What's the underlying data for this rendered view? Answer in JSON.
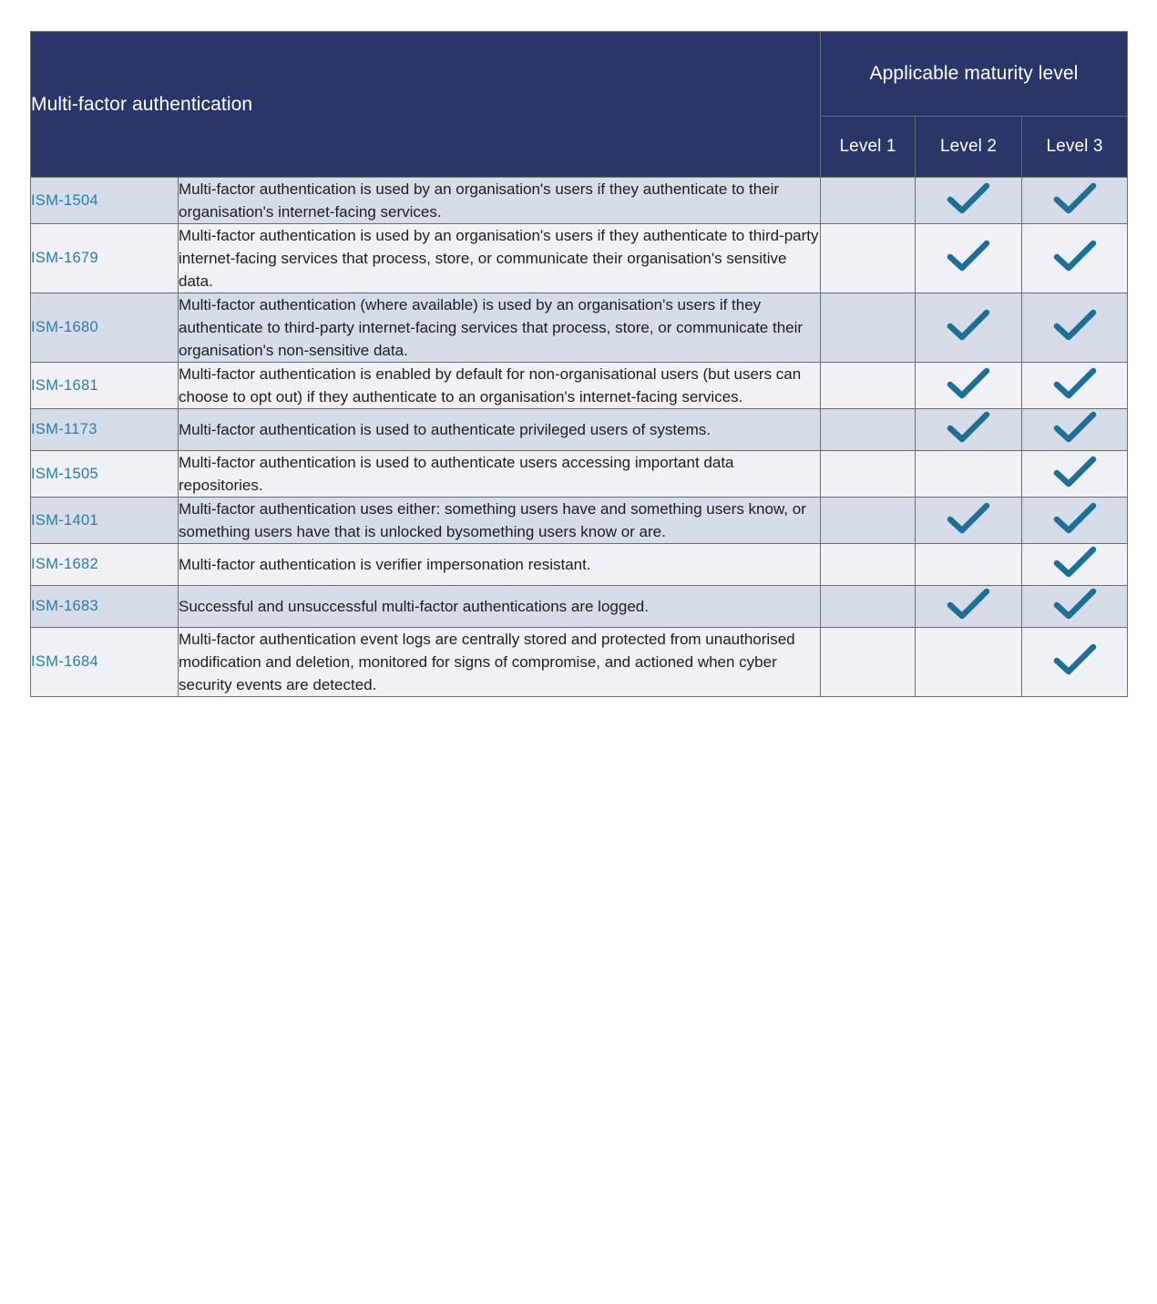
{
  "table": {
    "title": "Multi-factor authentication",
    "maturity_header": "Applicable maturity level",
    "level_headers": [
      "Level 1",
      "Level 2",
      "Level 3"
    ],
    "colors": {
      "header_navy": "#2a3568",
      "code_blue": "#2c7ba6",
      "check_teal": "#1e6e96",
      "row_shaded": "#d6dce8",
      "row_plain": "#f0f1f6",
      "border_grey": "#6a6d70"
    },
    "check_glyph": "check-icon",
    "rows": [
      {
        "code": "ISM-1504",
        "description": "Multi-factor authentication is used by an organisation's users if they authenticate to their organisation's internet-facing services.",
        "level1": false,
        "level2": true,
        "level3": true
      },
      {
        "code": "ISM-1679",
        "description": "Multi-factor authentication is used by an organisation's users if they authenticate to third-party internet-facing services that process, store, or communicate their organisation's sensitive data.",
        "level1": false,
        "level2": true,
        "level3": true
      },
      {
        "code": "ISM-1680",
        "description": "Multi-factor authentication (where available) is used by an organisation's users if they authenticate to third-party internet-facing services that process, store, or communicate their organisation's non-sensitive data.",
        "level1": false,
        "level2": true,
        "level3": true
      },
      {
        "code": "ISM-1681",
        "description": "Multi-factor authentication is enabled by default for non-organisational users (but users can choose to opt out) if they authenticate to an organisation's internet-facing services.",
        "level1": false,
        "level2": true,
        "level3": true
      },
      {
        "code": "ISM-1173",
        "description": "Multi-factor authentication is used to authenticate privileged users of systems.",
        "level1": false,
        "level2": true,
        "level3": true
      },
      {
        "code": "ISM-1505",
        "description": "Multi-factor authentication is used to authenticate users accessing important data repositories.",
        "level1": false,
        "level2": false,
        "level3": true
      },
      {
        "code": "ISM-1401",
        "description": "Multi-factor authentication uses either: something users have and something users know, or something users have that is unlocked bysomething users know or are.",
        "level1": false,
        "level2": true,
        "level3": true
      },
      {
        "code": "ISM-1682",
        "description": "Multi-factor authentication is verifier impersonation resistant.",
        "level1": false,
        "level2": false,
        "level3": true
      },
      {
        "code": "ISM-1683",
        "description": "Successful and unsuccessful multi-factor authentications are logged.",
        "level1": false,
        "level2": true,
        "level3": true
      },
      {
        "code": "ISM-1684",
        "description": "Multi-factor authentication event logs are centrally stored and protected from unauthorised modification and deletion, monitored for signs of compromise, and actioned when cyber security events are detected.",
        "level1": false,
        "level2": false,
        "level3": true
      }
    ]
  }
}
